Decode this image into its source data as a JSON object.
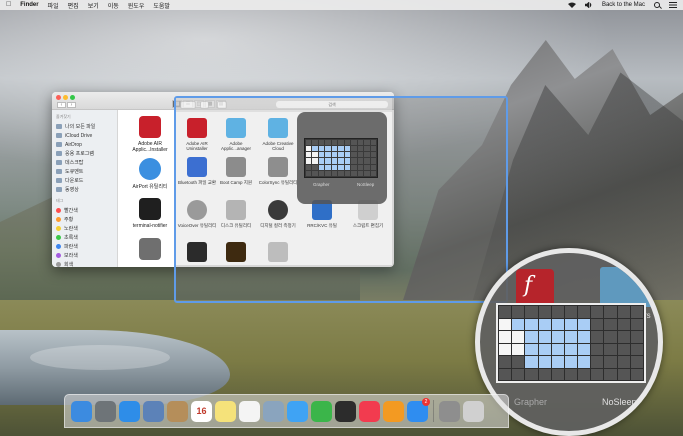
{
  "menubar": {
    "app_name": "Finder",
    "menus": [
      "파일",
      "편집",
      "보기",
      "이동",
      "윈도우",
      "도움말"
    ],
    "right_text": "Back to the Mac"
  },
  "finder": {
    "sidebar": {
      "favorites_header": "즐겨찾기",
      "favorites": [
        "나의 모든 파일",
        "iCloud Drive",
        "AirDrop",
        "응용 프로그램",
        "데스크탑",
        "도큐멘트",
        "다운로드",
        "동영상"
      ],
      "tags_header": "태그",
      "tags": [
        {
          "label": "빨간색",
          "color": "#ff4d4d"
        },
        {
          "label": "주황",
          "color": "#ff9b2e"
        },
        {
          "label": "노란색",
          "color": "#f5d033"
        },
        {
          "label": "초록색",
          "color": "#3cc84a"
        },
        {
          "label": "파란색",
          "color": "#3d86f0"
        },
        {
          "label": "보라색",
          "color": "#a55ce0"
        },
        {
          "label": "회색",
          "color": "#9a9a9a"
        }
      ]
    },
    "apps": [
      {
        "label": "Adobe AIR Applic...Installer",
        "color": "#c8202b"
      },
      {
        "label": "AirPort 유틸리티",
        "color": "#3b8fe0"
      },
      {
        "label": "terminal-notifier",
        "color": "#1f1f1f"
      },
      {
        "label": "",
        "color": "#6f6f6f"
      }
    ]
  },
  "overlay": {
    "search_placeholder": "검색",
    "apps": [
      {
        "label": "Adobe AIR Uninstaller",
        "color": "#c8202b"
      },
      {
        "label": "Adobe Applic...anager",
        "color": "#5fb2e3"
      },
      {
        "label": "Adobe Creative Cloud",
        "color": "#5fb2e3"
      },
      {
        "label": "Bluetooth 파일 교환",
        "color": "#3c6fd1"
      },
      {
        "label": "Boot Camp 지원",
        "color": "#8c8c8c"
      },
      {
        "label": "ColorSync 유틸리티",
        "color": "#8e8e8e"
      },
      {
        "label": "VoiceOver 유틸리티",
        "color": "#9a9a9a"
      },
      {
        "label": "디스크 유틸리티",
        "color": "#b4b4b4"
      },
      {
        "label": "디지털 컬러 측정기",
        "color": "#3a3a3a"
      },
      {
        "label": "RRC/KVC 유틸",
        "color": "#2f6fc7"
      },
      {
        "label": "스크립트 편집기",
        "color": "#cfcfcf"
      },
      {
        "label": "",
        "color": "#2b2b2b"
      },
      {
        "label": "",
        "color": "#3e2a10"
      },
      {
        "label": "",
        "color": "#bdbdbd"
      }
    ],
    "popup_labels": [
      "Grapher",
      "NoSleep"
    ]
  },
  "magnifier": {
    "label_grapher": "Grapher",
    "label_nosleep": "NoSleep",
    "side_text": "rs"
  },
  "dock": {
    "apps": [
      {
        "name": "finder-icon",
        "color": "#3c8be0"
      },
      {
        "name": "launchpad-icon",
        "color": "#6e7478"
      },
      {
        "name": "safari-icon",
        "color": "#2e8de8"
      },
      {
        "name": "photo-icon",
        "color": "#5c82b8"
      },
      {
        "name": "contacts-icon",
        "color": "#b58e5a"
      },
      {
        "name": "calendar-icon",
        "color": "#ffffff",
        "text": "16"
      },
      {
        "name": "notes-icon",
        "color": "#f5e27a"
      },
      {
        "name": "reminders-icon",
        "color": "#f4f4f4"
      },
      {
        "name": "preview-icon",
        "color": "#8aa4be"
      },
      {
        "name": "messages-icon",
        "color": "#3fa3f4"
      },
      {
        "name": "facetime-icon",
        "color": "#3bb54a"
      },
      {
        "name": "photobooth-icon",
        "color": "#2c2c2c"
      },
      {
        "name": "music-icon",
        "color": "#f23b4f"
      },
      {
        "name": "ibooks-icon",
        "color": "#f39a22"
      },
      {
        "name": "appstore-icon",
        "color": "#2f8df0",
        "badge": "2"
      },
      {
        "name": "system-preferences-icon",
        "color": "#8e8e8e"
      },
      {
        "name": "trash-icon",
        "color": "#d0d0d0"
      }
    ]
  }
}
